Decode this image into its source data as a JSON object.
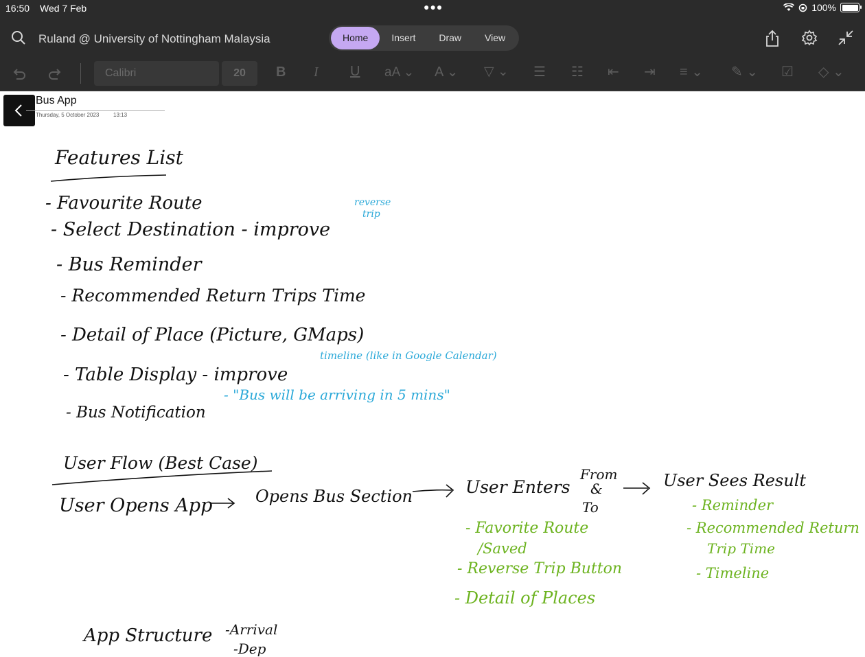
{
  "status": {
    "time": "16:50",
    "date": "Wed 7 Feb",
    "battery": "100%"
  },
  "header": {
    "notebook": "Ruland @ University of Nottingham Malaysia",
    "tabs": [
      "Home",
      "Insert",
      "Draw",
      "View"
    ],
    "active_tab": "Home"
  },
  "toolbar": {
    "font": "Calibri",
    "size": "20"
  },
  "page": {
    "title": "Bus App",
    "date": "Thursday, 5 October 2023",
    "time": "13:13"
  },
  "notes": {
    "features_heading": "Features List",
    "f1": "- Favourite Route",
    "f2": "- Select Destination - improve",
    "f2_note_a": "reverse",
    "f2_note_b": "trip",
    "f3": "- Bus Reminder",
    "f4": "- Recommended Return Trips Time",
    "f5": "- Detail of Place (Picture, GMaps)",
    "f6": "- Table Display - improve",
    "f6_note": "timeline (like in Google Calendar)",
    "f7": "- Bus Notification",
    "f7_note": "- \"Bus will be arriving in 5 mins\"",
    "flow_heading": "User Flow (Best Case)",
    "flow_1": "User Opens App",
    "flow_2": "Opens Bus Section",
    "flow_3": "User Enters",
    "flow_from": "From",
    "flow_amp": "&",
    "flow_to": "To",
    "flow_4": "User Sees Result",
    "sub_a1": "- Favorite Route",
    "sub_a1b": "/Saved",
    "sub_a2": "- Reverse Trip Button",
    "sub_a3": "- Detail of Places",
    "sub_b1": "- Reminder",
    "sub_b2": "- Recommended Return",
    "sub_b2b": "Trip Time",
    "sub_b3": "- Timeline",
    "structure": "App Structure",
    "structure_1": "-Arrival",
    "structure_2": "-Dep"
  },
  "colors": {
    "accent_tab": "#c5a8f2",
    "ink_blue": "#29a8d8",
    "ink_green": "#6cb31f"
  }
}
